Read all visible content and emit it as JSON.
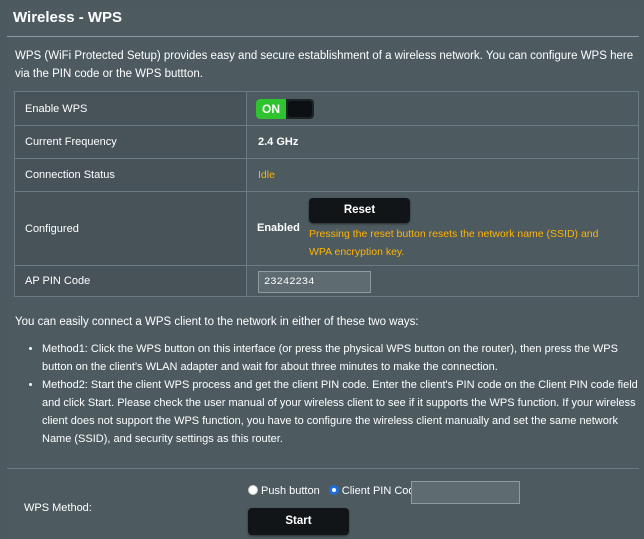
{
  "header": {
    "title": "Wireless - WPS",
    "description": "WPS (WiFi Protected Setup) provides easy and secure establishment of a wireless network. You can configure WPS here via the PIN code or the WPS buttton."
  },
  "settings": {
    "enable_wps": {
      "label": "Enable WPS",
      "toggle_text": "ON",
      "state": "on"
    },
    "frequency": {
      "label": "Current Frequency",
      "value": "2.4 GHz"
    },
    "status": {
      "label": "Connection Status",
      "value": "Idle"
    },
    "configured": {
      "label": "Configured",
      "value": "Enabled",
      "reset_label": "Reset",
      "note": "Pressing the reset button resets the network name (SSID) and WPA encryption key."
    },
    "ap_pin": {
      "label": "AP PIN Code",
      "value": "23242234"
    }
  },
  "ways_intro": "You can easily connect a WPS client to the network in either of these two ways:",
  "methods": [
    "Method1: Click the WPS button on this interface (or press the physical WPS button on the router), then press the WPS button on the client's WLAN adapter and wait for about three minutes to make the connection.",
    "Method2: Start the client WPS process and get the client PIN code. Enter the client's PIN code on the Client PIN code field and click Start. Please check the user manual of your wireless client to see if it supports the WPS function. If your wireless client does not support the WPS function, you have to configure the wireless client manually and set the same network Name (SSID), and security settings as this router."
  ],
  "wps_method": {
    "label": "WPS Method:",
    "options": [
      "Push button",
      "Client PIN Code"
    ],
    "selected": "Client PIN Code",
    "pin_value": "",
    "start_label": "Start"
  },
  "colors": {
    "accent_orange": "#ffb300",
    "toggle_green": "#2fc32f",
    "panel_bg": "#4d5b61"
  }
}
